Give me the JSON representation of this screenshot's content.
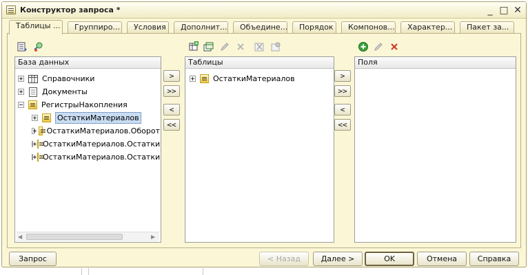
{
  "window": {
    "title": "Конструктор запроса *",
    "controls": {
      "minimize": "_",
      "maximize": "□",
      "close": "✕"
    }
  },
  "tabs": [
    {
      "label": "Таблицы ...",
      "active": true
    },
    {
      "label": "Группиро...",
      "active": false
    },
    {
      "label": "Условия",
      "active": false
    },
    {
      "label": "Дополнит...",
      "active": false
    },
    {
      "label": "Объедине...",
      "active": false
    },
    {
      "label": "Порядок",
      "active": false
    },
    {
      "label": "Компонов...",
      "active": false
    },
    {
      "label": "Характер...",
      "active": false
    },
    {
      "label": "Пакет за...",
      "active": false
    }
  ],
  "database_panel": {
    "header": "База данных",
    "items": [
      {
        "label": "Справочники",
        "icon": "catalog-icon"
      },
      {
        "label": "Документы",
        "icon": "document-icon"
      },
      {
        "label": "РегистрыНакопления",
        "icon": "accumulation-register-icon",
        "expanded": true
      },
      {
        "label": "ОстаткиМатериалов",
        "icon": "register-icon",
        "selected": true
      },
      {
        "label": "ОстаткиМатериалов.Оборот",
        "icon": "register-icon"
      },
      {
        "label": "ОстаткиМатериалов.Остатки",
        "icon": "register-icon"
      },
      {
        "label": "ОстаткиМатериалов.Остатки",
        "icon": "register-icon"
      }
    ]
  },
  "tables_panel": {
    "header": "Таблицы",
    "items": [
      {
        "label": "ОстаткиМатериалов",
        "icon": "register-icon"
      }
    ]
  },
  "fields_panel": {
    "header": "Поля",
    "items": []
  },
  "move_buttons": {
    "add": ">",
    "add_all": ">>",
    "remove": "<",
    "remove_all": "<<"
  },
  "footer": {
    "query": "Запрос",
    "back": "< Назад",
    "next": "Далее >",
    "ok": "OK",
    "cancel": "Отмена",
    "help": "Справка"
  },
  "colors": {
    "dialog_bg": "#fbf7d6",
    "selection": "#c9dcf2",
    "delete_red": "#d03a2a",
    "add_green": "#3aa23a"
  }
}
